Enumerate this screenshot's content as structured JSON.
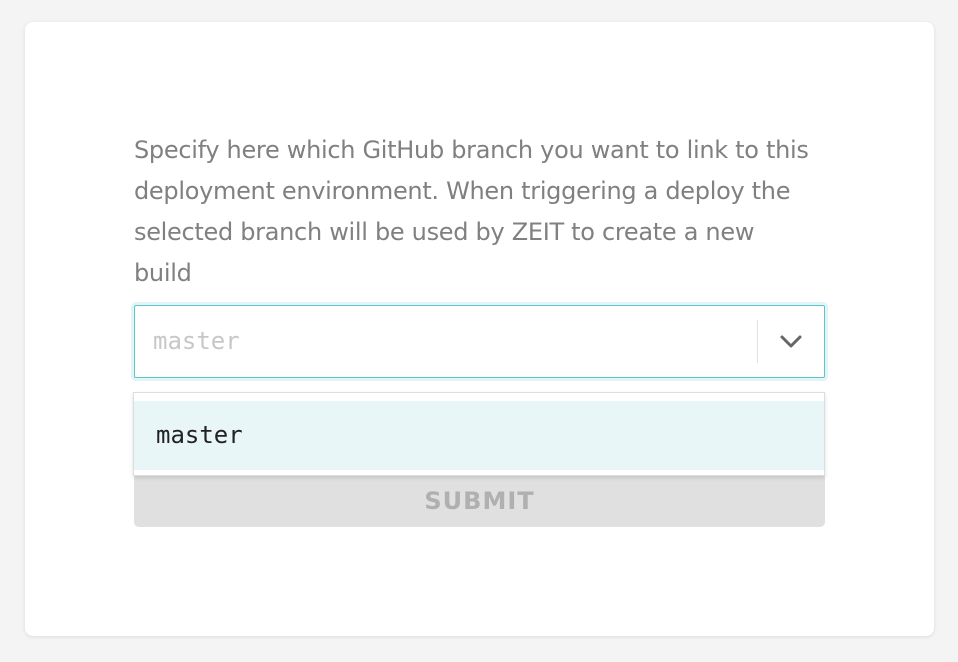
{
  "form": {
    "description": "Specify here which GitHub branch you want to link to this deployment environment. When triggering a deploy the selected branch will be used by ZEIT to create a new build",
    "branch_select": {
      "placeholder": "master",
      "options": [
        "master"
      ],
      "highlighted_option": "master",
      "icon": "chevron-down-icon"
    },
    "submit_label": "SUBMIT"
  },
  "colors": {
    "focus_border": "#5fc4c9",
    "option_highlight": "#e9f6f8",
    "description_text": "#808080",
    "submit_bg": "#e0e0e0"
  }
}
